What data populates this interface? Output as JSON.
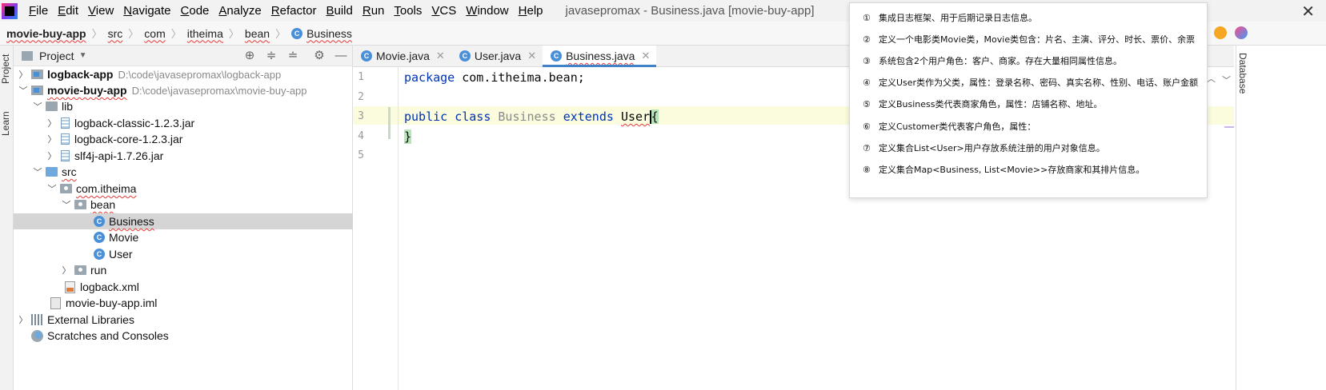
{
  "menubar": {
    "items": [
      "File",
      "Edit",
      "View",
      "Navigate",
      "Code",
      "Analyze",
      "Refactor",
      "Build",
      "Run",
      "Tools",
      "VCS",
      "Window",
      "Help"
    ],
    "window_title": "javasepromax - Business.java [movie-buy-app]"
  },
  "navbar": {
    "crumbs": [
      "movie-buy-app",
      "src",
      "com",
      "itheima",
      "bean",
      "Business"
    ]
  },
  "left_strip": {
    "project_tab": "Project",
    "learn_tab": "Learn"
  },
  "project_panel": {
    "title": "Project",
    "tree": [
      {
        "label": "logback-app",
        "path": "D:\\code\\javasepromax\\logback-app"
      },
      {
        "label": "movie-buy-app",
        "path": "D:\\code\\javasepromax\\movie-buy-app"
      },
      {
        "label": "lib"
      },
      {
        "label": "logback-classic-1.2.3.jar"
      },
      {
        "label": "logback-core-1.2.3.jar"
      },
      {
        "label": "slf4j-api-1.7.26.jar"
      },
      {
        "label": "src"
      },
      {
        "label": "com.itheima"
      },
      {
        "label": "bean"
      },
      {
        "label": "Business"
      },
      {
        "label": "Movie"
      },
      {
        "label": "User"
      },
      {
        "label": "run"
      },
      {
        "label": "logback.xml"
      },
      {
        "label": "movie-buy-app.iml"
      },
      {
        "label": "External Libraries"
      },
      {
        "label": "Scratches and Consoles"
      }
    ]
  },
  "editor": {
    "tabs": [
      {
        "label": "Movie.java",
        "active": false
      },
      {
        "label": "User.java",
        "active": false
      },
      {
        "label": "Business.java",
        "active": true
      }
    ],
    "line_numbers": [
      "1",
      "2",
      "3",
      "4",
      "5"
    ],
    "code": {
      "line1_kw": "package",
      "line1_rest": " com.itheima.bean;",
      "line3_kw1": "public",
      "line3_kw2": "class",
      "line3_name": "Business",
      "line3_kw3": "extends",
      "line3_super": "User",
      "line3_brace": "{",
      "line4_brace": "}"
    }
  },
  "right_strip": {
    "database_tab": "Database"
  },
  "note": {
    "lines": [
      {
        "num": "①",
        "text": "集成日志框架、用于后期记录日志信息。"
      },
      {
        "num": "②",
        "text": "定义一个电影类Movie类，Movie类包含：片名、主演、评分、时长、票价、余票"
      },
      {
        "num": "③",
        "text": "系统包含2个用户角色：客户、商家。存在大量相同属性信息。"
      },
      {
        "num": "④",
        "text": "定义User类作为父类，属性：登录名称、密码、真实名称、性别、电话、账户金额"
      },
      {
        "num": "⑤",
        "text": "定义Business类代表商家角色，属性：店铺名称、地址。"
      },
      {
        "num": "⑥",
        "text": "定义Customer类代表客户角色，属性："
      },
      {
        "num": "⑦",
        "text": "定义集合List<User>用户存放系统注册的用户对象信息。"
      },
      {
        "num": "⑧",
        "text": "定义集合Map<Business, List<Movie>>存放商家和其排片信息。"
      }
    ]
  },
  "colors": {
    "keyword": "#0033b3",
    "active_tab_underline": "#4083c9",
    "selection": "#d5d5d5",
    "caret_line": "#fbfbdd",
    "error_squiggle": "#e53935"
  }
}
